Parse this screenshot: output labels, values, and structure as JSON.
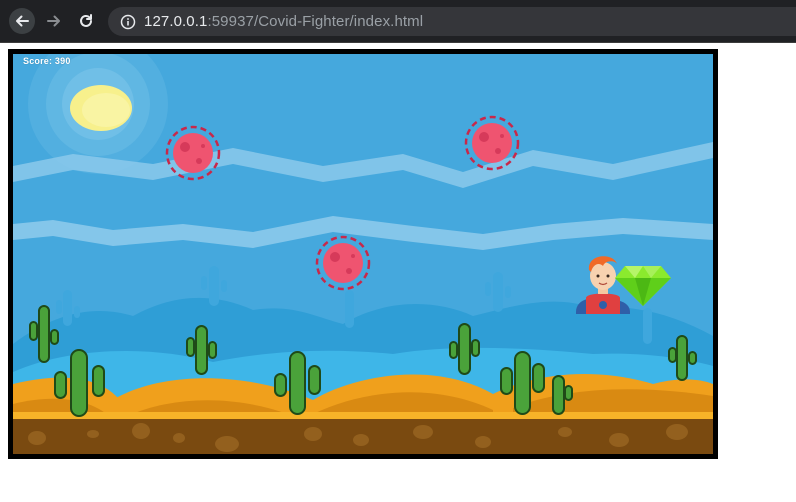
{
  "browser": {
    "url_host": "127.0.0.1",
    "url_rest": ":59937/Covid-Fighter/index.html",
    "icons": [
      "back-arrow-icon",
      "forward-arrow-icon",
      "reload-icon",
      "info-icon"
    ]
  },
  "game": {
    "score_label": "Score: 390",
    "entities": [
      "sun",
      "virus",
      "virus",
      "virus",
      "hero",
      "green-gem",
      "cactus",
      "ground"
    ],
    "colors": {
      "sky": "#45a8dd",
      "virus": "#ef5470",
      "sand": "#f0a01c",
      "ground": "#7a4a10",
      "cactus": "#4aa23a",
      "gem": "#8bea2e",
      "frame": "#000000"
    }
  }
}
